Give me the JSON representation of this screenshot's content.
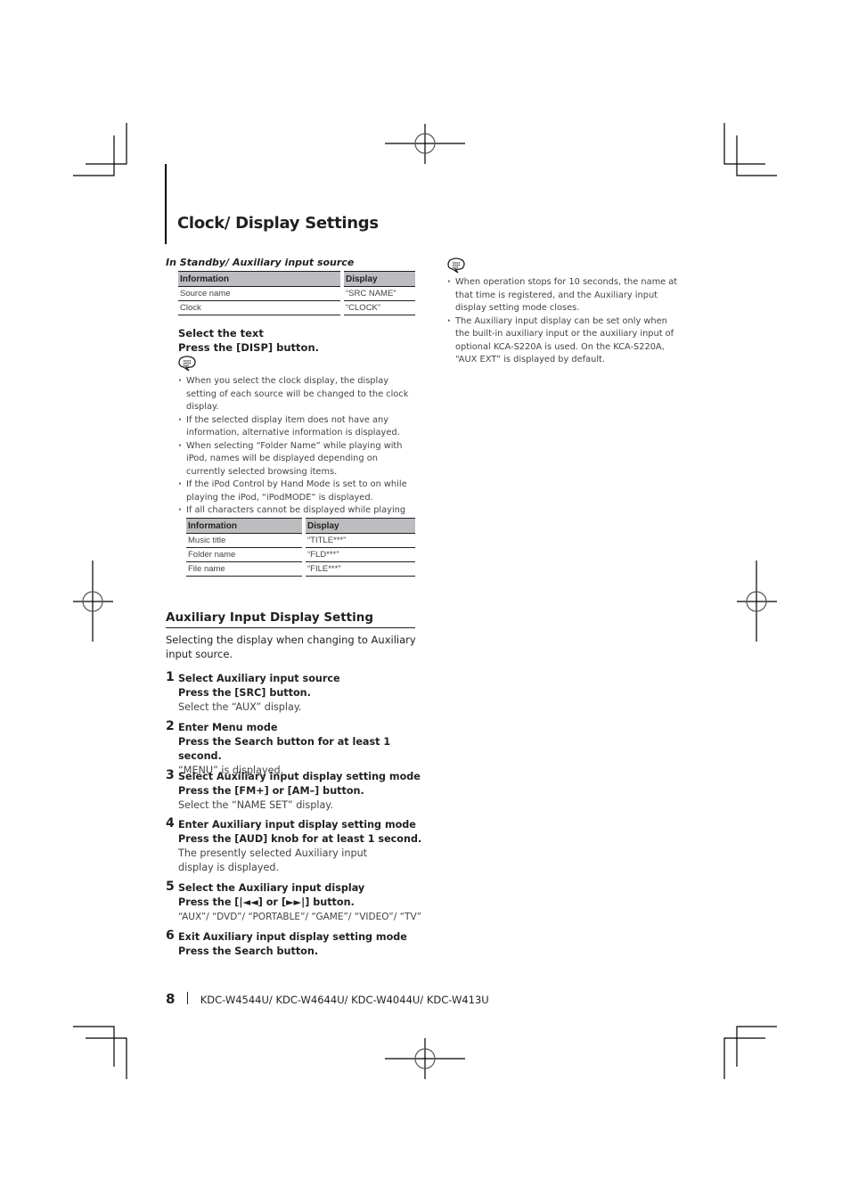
{
  "page_title": "Clock/ Display Settings",
  "standby_section": {
    "subhead": "In Standby/ Auxiliary input source",
    "table": {
      "headers": [
        "Information",
        "Display"
      ],
      "rows": [
        [
          "Source name",
          "“SRC NAME”"
        ],
        [
          "Clock",
          "“CLOCK”"
        ]
      ]
    },
    "action_title": "Select the text",
    "action_instruction": "Press the [DISP] button.",
    "notes": [
      "When you select the clock display, the display setting of each source will be changed to the clock display.",
      "If the selected display item does not have any information, alternative information is displayed.",
      "When selecting “Folder Name” while playing with iPod, names will be displayed depending on currently selected browsing items.",
      "If the iPod Control by Hand Mode is set to on while playing the iPod, “iPodMODE” is displayed.",
      "If all characters cannot be displayed while playing with iPod, the file number in the list is displayed."
    ],
    "ipod_table": {
      "headers": [
        "Information",
        "Display"
      ],
      "rows": [
        [
          "Music title",
          "“TITLE***”"
        ],
        [
          "Folder name",
          "“FLD***”"
        ],
        [
          "File name",
          "“FILE***”"
        ]
      ]
    }
  },
  "aux_section": {
    "title": "Auxiliary Input Display Setting",
    "intro": "Selecting the display when changing to Auxiliary input source.",
    "steps": [
      {
        "num": "1",
        "title": "Select Auxiliary input source",
        "instruction": "Press the [SRC] button.",
        "result": "Select the “AUX” display."
      },
      {
        "num": "2",
        "title": "Enter Menu mode",
        "instruction": "Press the Search button for at least 1 second.",
        "result": "“MENU” is displayed."
      },
      {
        "num": "3",
        "title": "Select Auxiliary input display setting mode",
        "instruction": "Press the [FM+] or [AM–] button.",
        "result": "Select the “NAME SET” display."
      },
      {
        "num": "4",
        "title": "Enter Auxiliary input display setting mode",
        "instruction": "Press the [AUD] knob for at least 1 second.",
        "result": "The presently selected Auxiliary input display is displayed."
      },
      {
        "num": "5",
        "title": "Select the Auxiliary input display",
        "instruction": "Press the [|◄◄] or [►►|] button.",
        "result": "“AUX”/ “DVD”/ “PORTABLE”/ “GAME”/ “VIDEO”/ “TV”"
      },
      {
        "num": "6",
        "title": "Exit Auxiliary input display setting mode",
        "instruction": "Press the Search button.",
        "result": ""
      }
    ],
    "notes": [
      "When operation stops for 10 seconds, the name at that time is registered, and the Auxiliary input display setting mode closes.",
      "The Auxiliary input display can be set only when the built-in auxiliary input or the auxiliary input of optional KCA-S220A is used. On the KCA-S220A, “AUX EXT” is displayed by default."
    ]
  },
  "footer": {
    "page_number": "8",
    "models": "KDC-W4544U/ KDC-W4644U/ KDC-W4044U/ KDC-W413U"
  },
  "icons": {
    "note": "note-speech-bubble-icon",
    "crop_mark": "crop-mark-icon",
    "registration_mark": "registration-mark-icon"
  }
}
